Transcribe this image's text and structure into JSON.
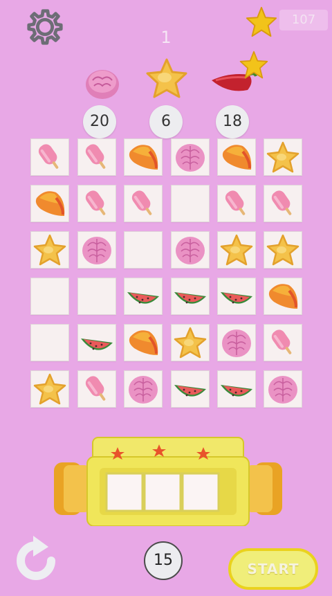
{
  "header": {
    "settings_icon": "gear-icon",
    "coins_icon": "star-icon",
    "coins": "107",
    "level": "1"
  },
  "goals": [
    {
      "item": "brain-candy",
      "count": "20"
    },
    {
      "item": "star-candy",
      "count": "6"
    },
    {
      "item": "chili-pepper",
      "count": "18",
      "has_star": true
    }
  ],
  "board": {
    "rows": [
      [
        "popsicle",
        "popsicle",
        "mango",
        "brain-candy",
        "mango",
        "star-candy"
      ],
      [
        "mango",
        "popsicle",
        "popsicle",
        "empty",
        "popsicle",
        "popsicle"
      ],
      [
        "star-candy",
        "brain-candy",
        "empty",
        "brain-candy",
        "star-candy",
        "star-candy"
      ],
      [
        "empty",
        "empty",
        "watermelon",
        "watermelon",
        "watermelon",
        "mango"
      ],
      [
        "empty",
        "watermelon",
        "mango",
        "star-candy",
        "brain-candy",
        "popsicle"
      ],
      [
        "star-candy",
        "popsicle",
        "brain-candy",
        "watermelon",
        "watermelon",
        "brain-candy"
      ]
    ]
  },
  "slot_machine": {
    "stars": 3,
    "reels": 3
  },
  "footer": {
    "moves": "15",
    "restart_icon": "restart-arrow-icon",
    "start_label": "START"
  },
  "colors": {
    "background": "#e8a8e6",
    "tile": "#f7f0f0",
    "machine": "#f0e65a",
    "start_button": "#f0ee7a"
  }
}
